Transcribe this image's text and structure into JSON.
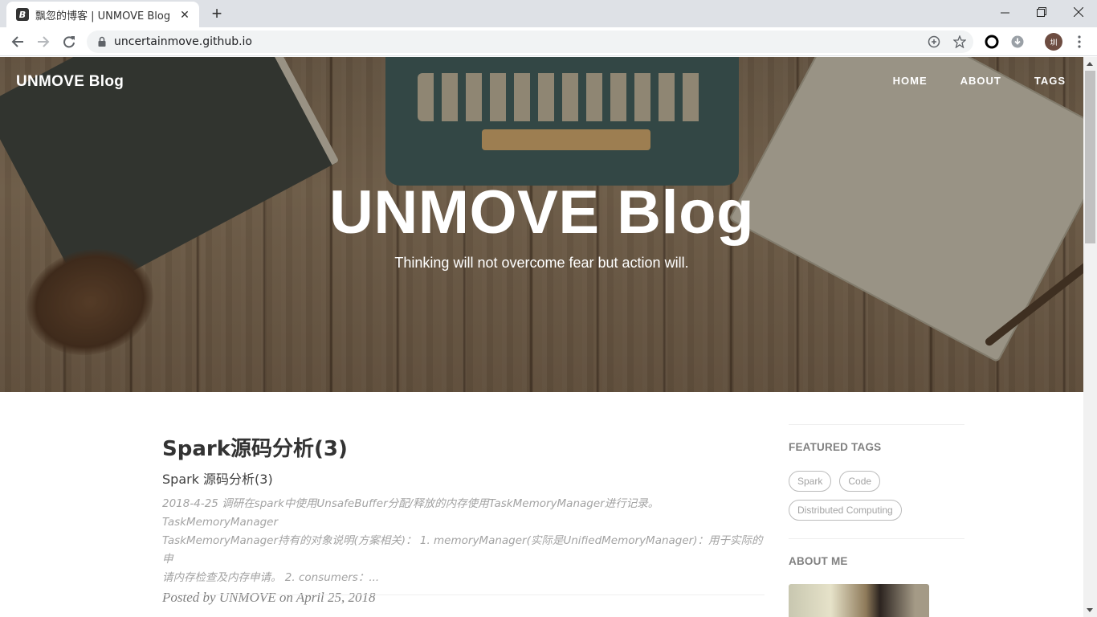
{
  "browser": {
    "tab_title": "飘忽的博客 | UNMOVE Blog",
    "tab_favicon_letter": "B",
    "url": "uncertainmove.github.io",
    "profile_initial": "圳"
  },
  "site": {
    "brand": "UNMOVE Blog",
    "nav": [
      "HOME",
      "ABOUT",
      "TAGS"
    ],
    "hero_title": "UNMOVE Blog",
    "hero_subtitle": "Thinking will not overcome fear but action will."
  },
  "post": {
    "title": "Spark源码分析(3)",
    "subtitle": "Spark 源码分析(3)",
    "excerpt_line1": "2018-4-25 调研在spark中使用UnsafeBuffer分配/释放的内存使用TaskMemoryManager进行记录。 TaskMemoryManager",
    "excerpt_line2": "TaskMemoryManager持有的对象说明(方案相关)： 1. memoryManager(实际是UnifiedMemoryManager)：用于实际的申",
    "excerpt_line3": "请内存检查及内存申请。 2. consumers：...",
    "meta": "Posted by UNMOVE on April 25, 2018"
  },
  "sidebar": {
    "featured_tags_heading": "FEATURED TAGS",
    "tags": [
      "Spark",
      "Code",
      "Distributed Computing"
    ],
    "about_heading": "ABOUT ME"
  }
}
